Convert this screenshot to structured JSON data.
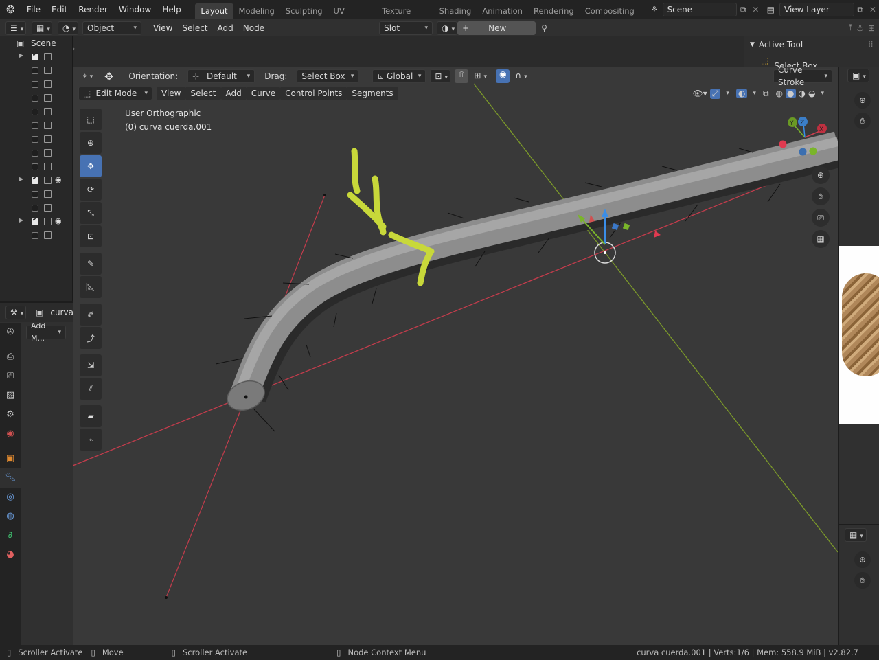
{
  "topbar": {
    "menus": [
      "File",
      "Edit",
      "Render",
      "Window",
      "Help"
    ],
    "workspaces": [
      "Layout",
      "Modeling",
      "Sculpting",
      "UV Editing",
      "Texture Paint",
      "Shading",
      "Animation",
      "Rendering",
      "Compositing"
    ],
    "active_workspace": "Layout",
    "scene": "Scene",
    "view_layer": "View Layer"
  },
  "node_header": {
    "object_mode": "Object",
    "menus": [
      "View",
      "Select",
      "Add",
      "Node"
    ],
    "slot": "Slot",
    "new_button": "New"
  },
  "outliner": {
    "scene_label": "Scene",
    "rows": [
      {
        "expand": true,
        "checked": true,
        "eye": false
      },
      {
        "expand": false,
        "checked": false,
        "eye": false
      },
      {
        "expand": false,
        "checked": false,
        "eye": false
      },
      {
        "expand": false,
        "checked": false,
        "eye": false
      },
      {
        "expand": false,
        "checked": false,
        "eye": false
      },
      {
        "expand": false,
        "checked": false,
        "eye": false
      },
      {
        "expand": false,
        "checked": false,
        "eye": false
      },
      {
        "expand": false,
        "checked": false,
        "eye": false
      },
      {
        "expand": false,
        "checked": false,
        "eye": false
      },
      {
        "expand": true,
        "checked": true,
        "eye": true
      },
      {
        "expand": false,
        "checked": false,
        "eye": false
      },
      {
        "expand": false,
        "checked": false,
        "eye": false
      },
      {
        "expand": true,
        "checked": true,
        "eye": true
      },
      {
        "expand": false,
        "checked": false,
        "eye": false
      }
    ]
  },
  "properties": {
    "object_name": "curva",
    "add_modifier": "Add M..."
  },
  "active_tool_panel": {
    "title": "Active Tool",
    "tool": "Select Box"
  },
  "viewport": {
    "orientation_label": "Orientation:",
    "orientation_value": "Default",
    "drag_label": "Drag:",
    "drag_value": "Select Box",
    "transform_space": "Global",
    "curve_stroke": "Curve Stroke",
    "mode": "Edit Mode",
    "menus": [
      "View",
      "Select",
      "Add",
      "Curve",
      "Control Points",
      "Segments"
    ],
    "view_name": "User Orthographic",
    "object_info": "(0) curva cuerda.001",
    "gizmo_axes": [
      "X",
      "Y",
      "Z"
    ],
    "accent_color": "#4772b3",
    "annotation_color": "#c8d83a"
  },
  "statusbar": {
    "left1": "Scroller Activate",
    "left2": "Move",
    "left3": "Scroller Activate",
    "left4": "Node Context Menu",
    "right": "curva cuerda.001 | Verts:1/6 | Mem: 558.9 MiB | v2.82.7"
  }
}
